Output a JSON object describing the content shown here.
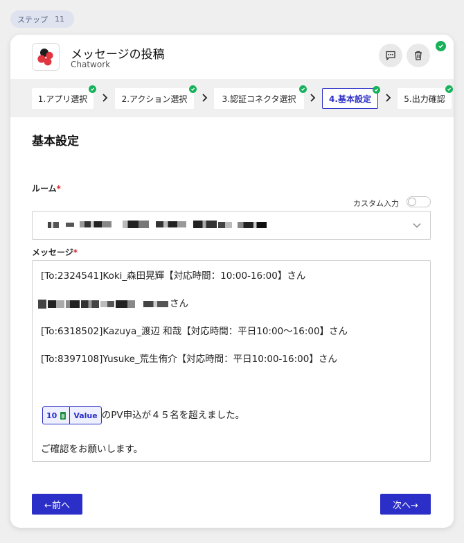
{
  "step_badge": {
    "label": "ステップ",
    "number": "11"
  },
  "header": {
    "action_title": "メッセージの投稿",
    "app_name": "Chatwork"
  },
  "stepper": {
    "steps": [
      {
        "label": "1.アプリ選択",
        "done": true
      },
      {
        "label": "2.アクション選択",
        "done": true
      },
      {
        "label": "3.認証コネクタ選択",
        "done": true
      },
      {
        "label": "4.基本設定",
        "done": true,
        "active": true
      },
      {
        "label": "5.出力確認",
        "done": true
      }
    ]
  },
  "form": {
    "section_title": "基本設定",
    "room": {
      "label": "ルーム",
      "required_mark": "*",
      "custom_input_label": "カスタム入力"
    },
    "message": {
      "label": "メッセージ",
      "required_mark": "*",
      "lines": {
        "l1": "[To:2324541]Koki_森田晃輝【対応時間：10:00-16:00】さん",
        "l2_suffix": "さん",
        "l3": "[To:6318502]Kazuya_渡辺 和哉【対応時間：平日10:00〜16:00】さん",
        "l4": "[To:8397108]Yusuke_荒生侑介【対応時間：平日10:00-16:00】さん",
        "l5_suffix": "のPV申込が４５名を超えました。",
        "l6": "ご確認をお願いします。"
      },
      "token": {
        "number": "10",
        "value": "Value"
      }
    }
  },
  "footer": {
    "prev_label": "←前へ",
    "next_label": "次へ→"
  },
  "colors": {
    "accent": "#2b2fc7",
    "success": "#18b15b",
    "required": "#d9292a"
  }
}
